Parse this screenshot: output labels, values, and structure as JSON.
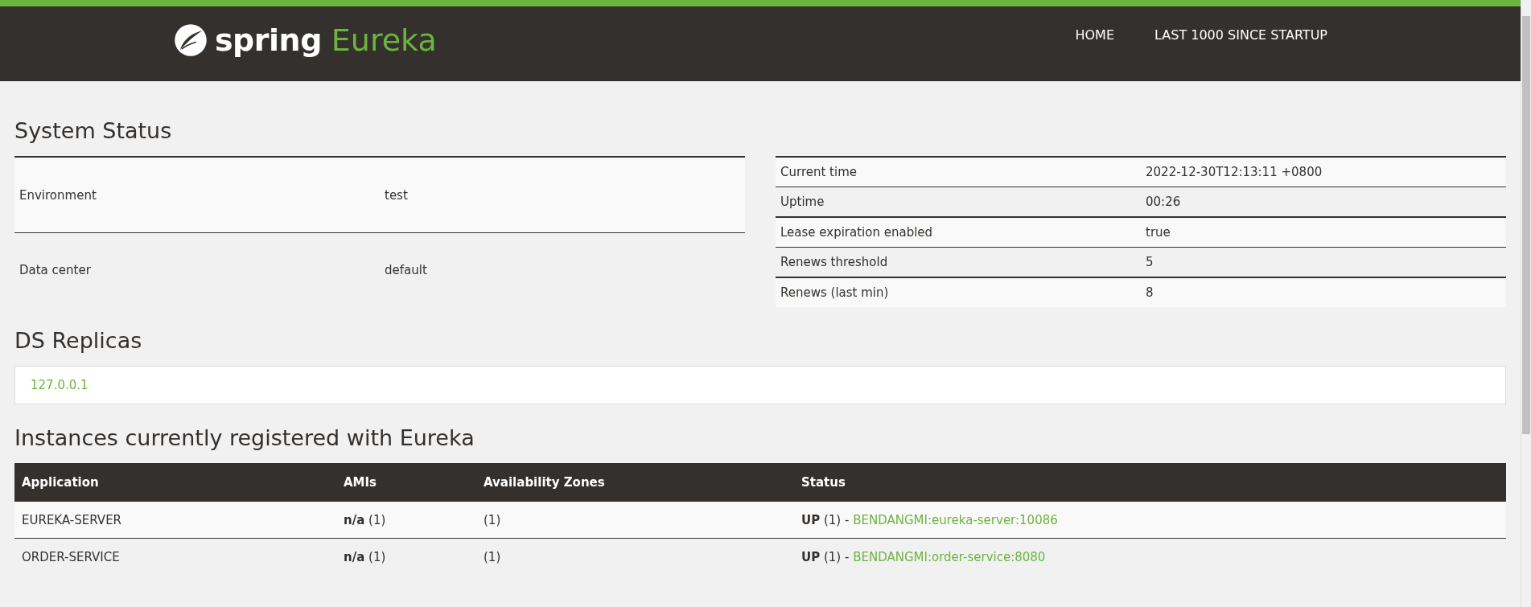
{
  "header": {
    "logo": {
      "word": "spring",
      "product": "Eureka"
    },
    "nav": [
      {
        "label": "HOME"
      },
      {
        "label": "LAST 1000 SINCE STARTUP"
      }
    ]
  },
  "system_status": {
    "title": "System Status",
    "left_rows": [
      {
        "label": "Environment",
        "value": "test"
      },
      {
        "label": "Data center",
        "value": "default"
      }
    ],
    "right_rows": [
      {
        "label": "Current time",
        "value": "2022-12-30T12:13:11 +0800"
      },
      {
        "label": "Uptime",
        "value": "00:26"
      },
      {
        "label": "Lease expiration enabled",
        "value": "true"
      },
      {
        "label": "Renews threshold",
        "value": "5"
      },
      {
        "label": "Renews (last min)",
        "value": "8"
      }
    ]
  },
  "ds_replicas": {
    "title": "DS Replicas",
    "items": [
      "127.0.0.1"
    ]
  },
  "instances": {
    "title": "Instances currently registered with Eureka",
    "columns": [
      "Application",
      "AMIs",
      "Availability Zones",
      "Status"
    ],
    "rows": [
      {
        "application": "EUREKA-SERVER",
        "amis": "**n/a** (1)",
        "zones": "(1)",
        "status": "**UP** (1) -",
        "instance": "BENDANGMI:eureka-server:10086"
      },
      {
        "application": "ORDER-SERVICE",
        "amis": "**n/a** (1)",
        "zones": "(1)",
        "status": "**UP** (1) -",
        "instance": "BENDANGMI:order-service:8080"
      }
    ]
  }
}
